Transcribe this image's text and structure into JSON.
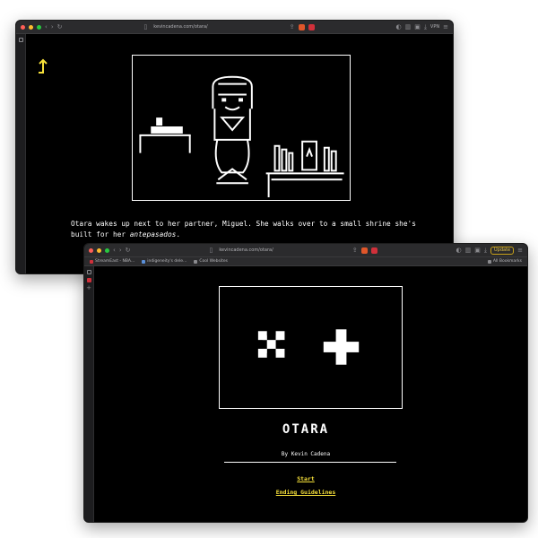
{
  "window_back": {
    "url": "kevincadena.com/otara/",
    "vpn_label": "VPN",
    "story": {
      "text_before": "Otara wakes up next to her partner, Miguel. She walks over to a small shrine she's built for her ",
      "emphasis": "antepasados",
      "text_after": "."
    },
    "icons": {
      "back": "back-arrow-icon",
      "scene": "bedroom-shrine-scene"
    },
    "accent_color": "#f6e03a"
  },
  "window_front": {
    "url": "kevincadena.com/otara/",
    "update_label": "Update",
    "bookmarks": [
      {
        "label": "StreamEast - NBA...",
        "color": "#d0303a"
      },
      {
        "label": "indigeneity's dele...",
        "color": "#5a8fd8"
      },
      {
        "label": "Cool Websites",
        "color": "#8a8a8e"
      }
    ],
    "all_bookmarks_label": "All Bookmarks",
    "title": "OTARA",
    "byline": "By Kevin Cadena",
    "start_label": "Start",
    "ending_label": "Ending Guidelines",
    "link_color": "#f6e03a"
  }
}
